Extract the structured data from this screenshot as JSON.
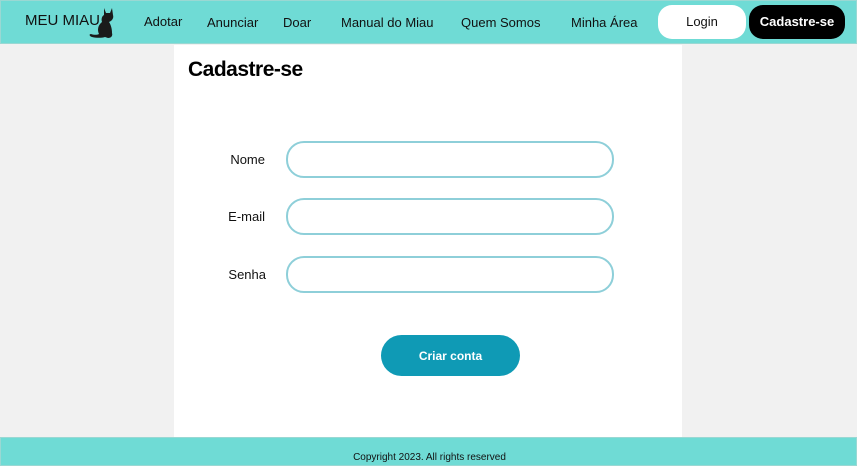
{
  "header": {
    "brand": "MEU MIAU",
    "nav": [
      {
        "label": "Adotar"
      },
      {
        "label": "Anunciar"
      },
      {
        "label": "Doar"
      },
      {
        "label": "Manual do Miau"
      },
      {
        "label": "Quem Somos"
      },
      {
        "label": "Minha Área"
      }
    ],
    "login_label": "Login",
    "signup_label": "Cadastre-se"
  },
  "form": {
    "title": "Cadastre-se",
    "fields": [
      {
        "label": "Nome",
        "value": "",
        "placeholder": ""
      },
      {
        "label": "E-mail",
        "value": "",
        "placeholder": ""
      },
      {
        "label": "Senha",
        "value": "",
        "placeholder": ""
      }
    ],
    "submit_label": "Criar conta"
  },
  "footer": {
    "copyright": "Copyright 2023. All rights reserved"
  },
  "colors": {
    "accent": "#6fdbd5",
    "button": "#0f9ab5",
    "field_border": "#8ecfd9"
  }
}
